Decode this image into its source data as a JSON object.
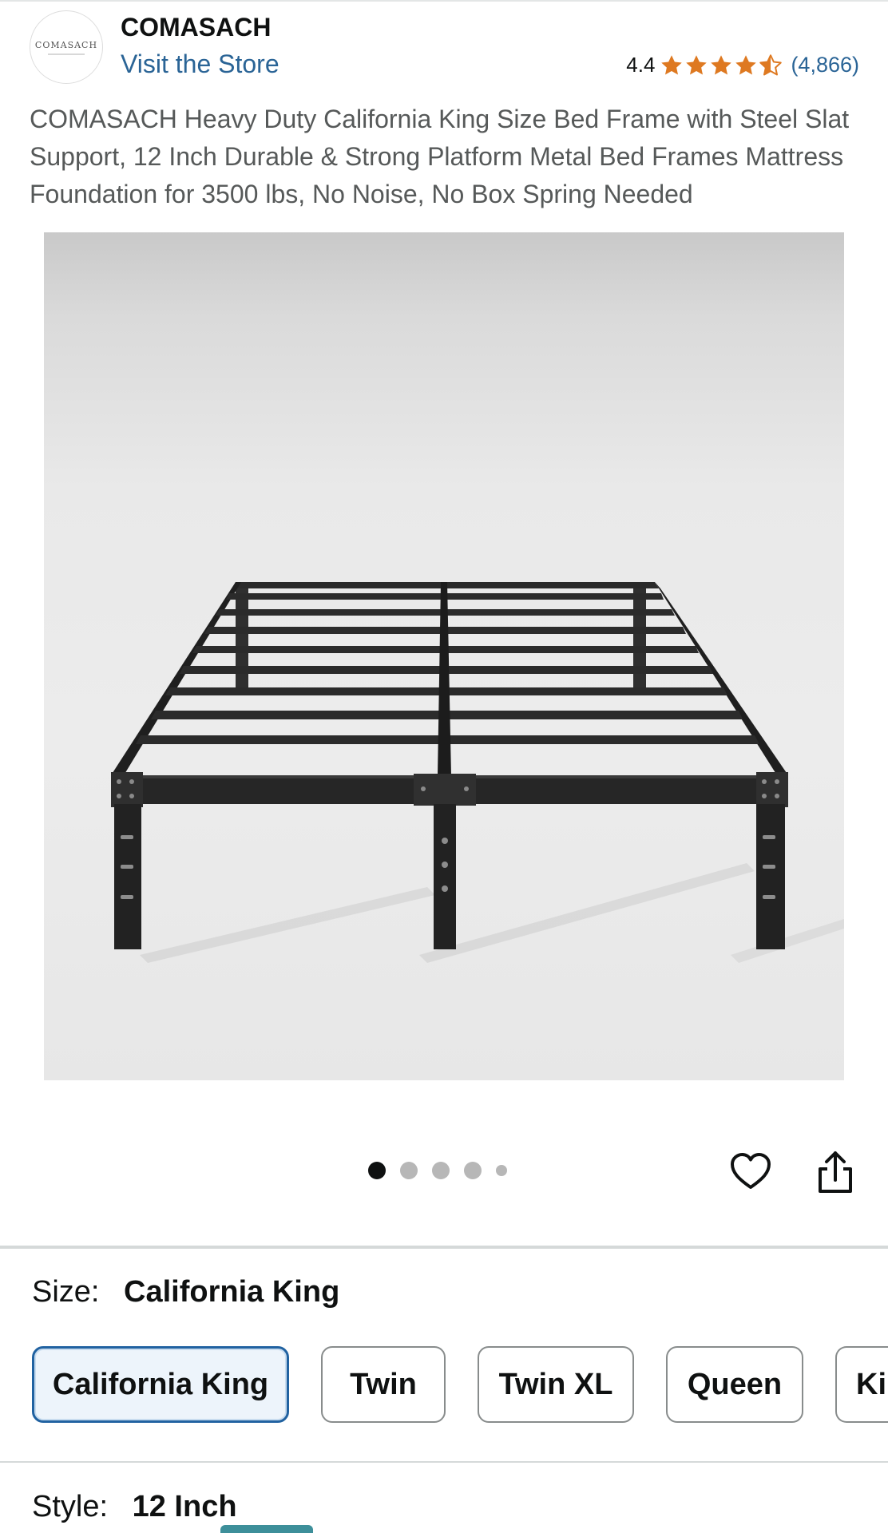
{
  "header": {
    "brand_logo_text": "COMASACH",
    "brand_name": "COMASACH",
    "visit_store": "Visit the Store",
    "rating_score": "4.4",
    "rating_stars": 4.4,
    "rating_count": "(4,866)"
  },
  "product": {
    "title": "COMASACH Heavy Duty California King Size Bed Frame with Steel Slat Support, 12 Inch Durable & Strong Platform Metal Bed Frames Mattress Foundation for 3500 lbs, No Noise, No Box Spring Needed",
    "image_alt": "metal-platform-bed-frame"
  },
  "carousel": {
    "total": 5,
    "active_index": 0
  },
  "actions": {
    "favorite_icon": "heart-icon",
    "share_icon": "share-icon"
  },
  "size": {
    "label": "Size:",
    "selected": "California King",
    "options": [
      "California King",
      "Twin",
      "Twin XL",
      "Queen",
      "Ki"
    ]
  },
  "style": {
    "label": "Style:",
    "selected": "12 Inch"
  },
  "colors": {
    "link": "#2a6496",
    "star": "#de7921",
    "selected_border": "#2162a1"
  }
}
